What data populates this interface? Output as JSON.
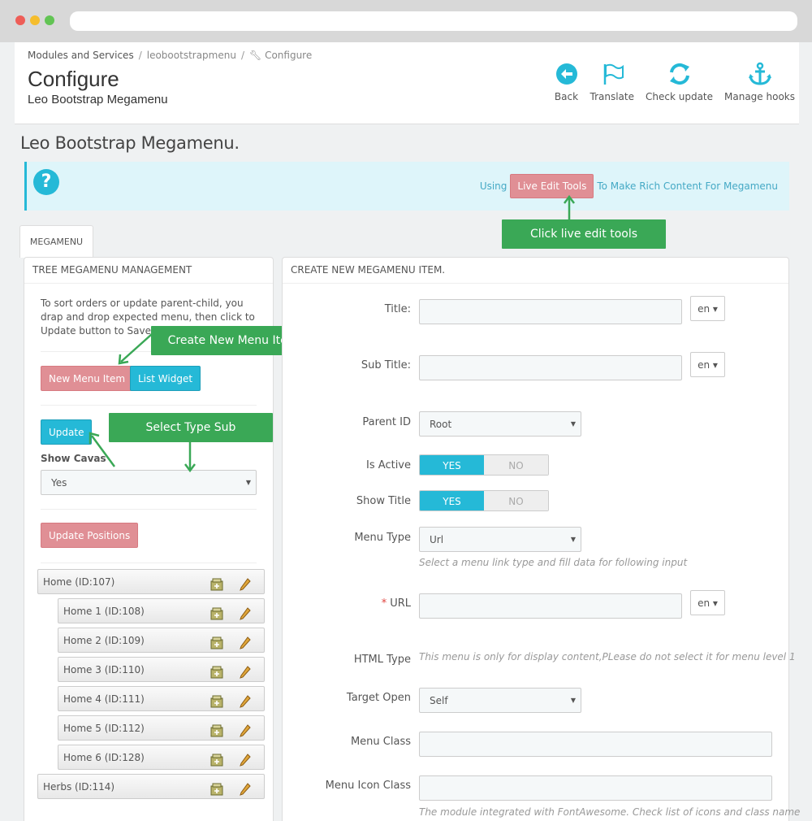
{
  "breadcrumb": {
    "item1": "Modules and Services",
    "item2": "leobootstrapmenu",
    "item3": "Configure"
  },
  "header": {
    "title": "Configure",
    "subtitle": "Leo Bootstrap Megamenu"
  },
  "toolbar": {
    "back": "Back",
    "translate": "Translate",
    "check_update": "Check update",
    "manage_hooks": "Manage hooks"
  },
  "module_title": "Leo Bootstrap Megamenu.",
  "alert": {
    "before": "Using",
    "button": "Live Edit Tools",
    "after": "To Make Rich Content For Megamenu"
  },
  "callouts": {
    "live_edit": "Click live edit tools",
    "new_item": "Create New Menu Item",
    "type_sub": "Select Type Sub"
  },
  "tab": {
    "label": "MEGAMENU"
  },
  "left_panel": {
    "heading": "TREE MEGAMENU MANAGEMENT",
    "help": "To sort orders or update parent-child, you drap and drop expected menu, then click to Update button to Save",
    "new_menu_item": "New Menu Item",
    "list_widget": "List Widget",
    "update": "Update",
    "show_cavas_label": "Show Cavas",
    "show_cavas_value": "Yes",
    "update_positions": "Update Positions",
    "tree": [
      "Home (ID:107)",
      "Home 1 (ID:108)",
      "Home 2 (ID:109)",
      "Home 3 (ID:110)",
      "Home 4 (ID:111)",
      "Home 5 (ID:112)",
      "Home 6 (ID:128)",
      "Herbs (ID:114)"
    ]
  },
  "right_panel": {
    "heading": "CREATE NEW MEGAMENU ITEM.",
    "title_label": "Title:",
    "sub_title_label": "Sub Title:",
    "lang": "en",
    "parent_id_label": "Parent ID",
    "parent_id_value": "Root",
    "is_active_label": "Is Active",
    "show_title_label": "Show Title",
    "yes": "YES",
    "no": "NO",
    "menu_type_label": "Menu Type",
    "menu_type_value": "Url",
    "menu_type_help": "Select a menu link type and fill data for following input",
    "required_mark": "*",
    "url_label": "URL",
    "html_type_label": "HTML Type",
    "html_type_help": "This menu is only for display content,PLease do not select it for menu level 1",
    "target_open_label": "Target Open",
    "target_open_value": "Self",
    "menu_class_label": "Menu Class",
    "menu_icon_class_label": "Menu Icon Class",
    "menu_icon_help": "The module integrated with FontAwesome. Check list of icons and class name"
  },
  "colors": {
    "accent": "#25b9d7",
    "pink": "#e08f95",
    "callout": "#3aa856"
  }
}
